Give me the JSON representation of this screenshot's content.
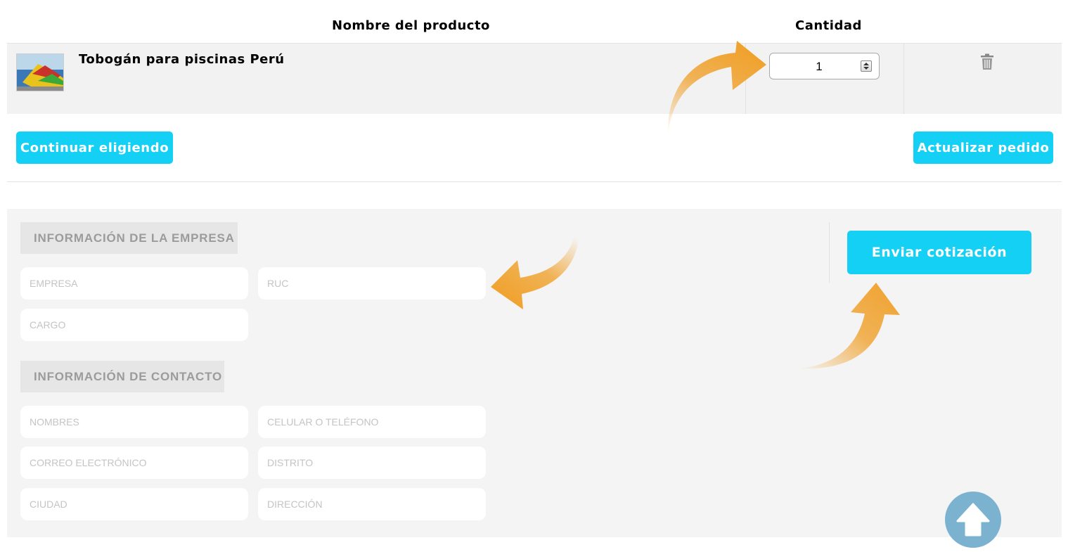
{
  "headers": {
    "product_name": "Nombre del producto",
    "quantity": "Cantidad"
  },
  "cart": {
    "items": [
      {
        "name": "Tobogán para piscinas Perú",
        "quantity": "1",
        "thumbnail": "slide-photo"
      }
    ],
    "delete_icon": "trash-icon"
  },
  "buttons": {
    "continue": "Continuar eligiendo",
    "update": "Actualizar pedido",
    "send": "Enviar cotización"
  },
  "form": {
    "company_section": {
      "title": "INFORMACIÓN DE LA EMPRESA",
      "fields": {
        "empresa": "EMPRESA",
        "ruc": "RUC",
        "cargo": "CARGO"
      }
    },
    "contact_section": {
      "title": "INFORMACIÓN DE CONTACTO",
      "fields": {
        "nombres": "NOMBRES",
        "telefono": "CELULAR O TELÉFONO",
        "correo": "CORREO ELECTRÓNICO",
        "distrito": "DISTRITO",
        "ciudad": "CIUDAD",
        "direccion": "DIRECCIÓN"
      }
    }
  },
  "colors": {
    "accent": "#14d0f5",
    "arrow": "#f0a22e",
    "scroll_top": "#7ab2cf",
    "panel": "#f4f4f4"
  },
  "icons": {
    "scroll_top": "arrow-up-icon",
    "delete": "trash-icon",
    "spinner": "spinner-icon"
  }
}
